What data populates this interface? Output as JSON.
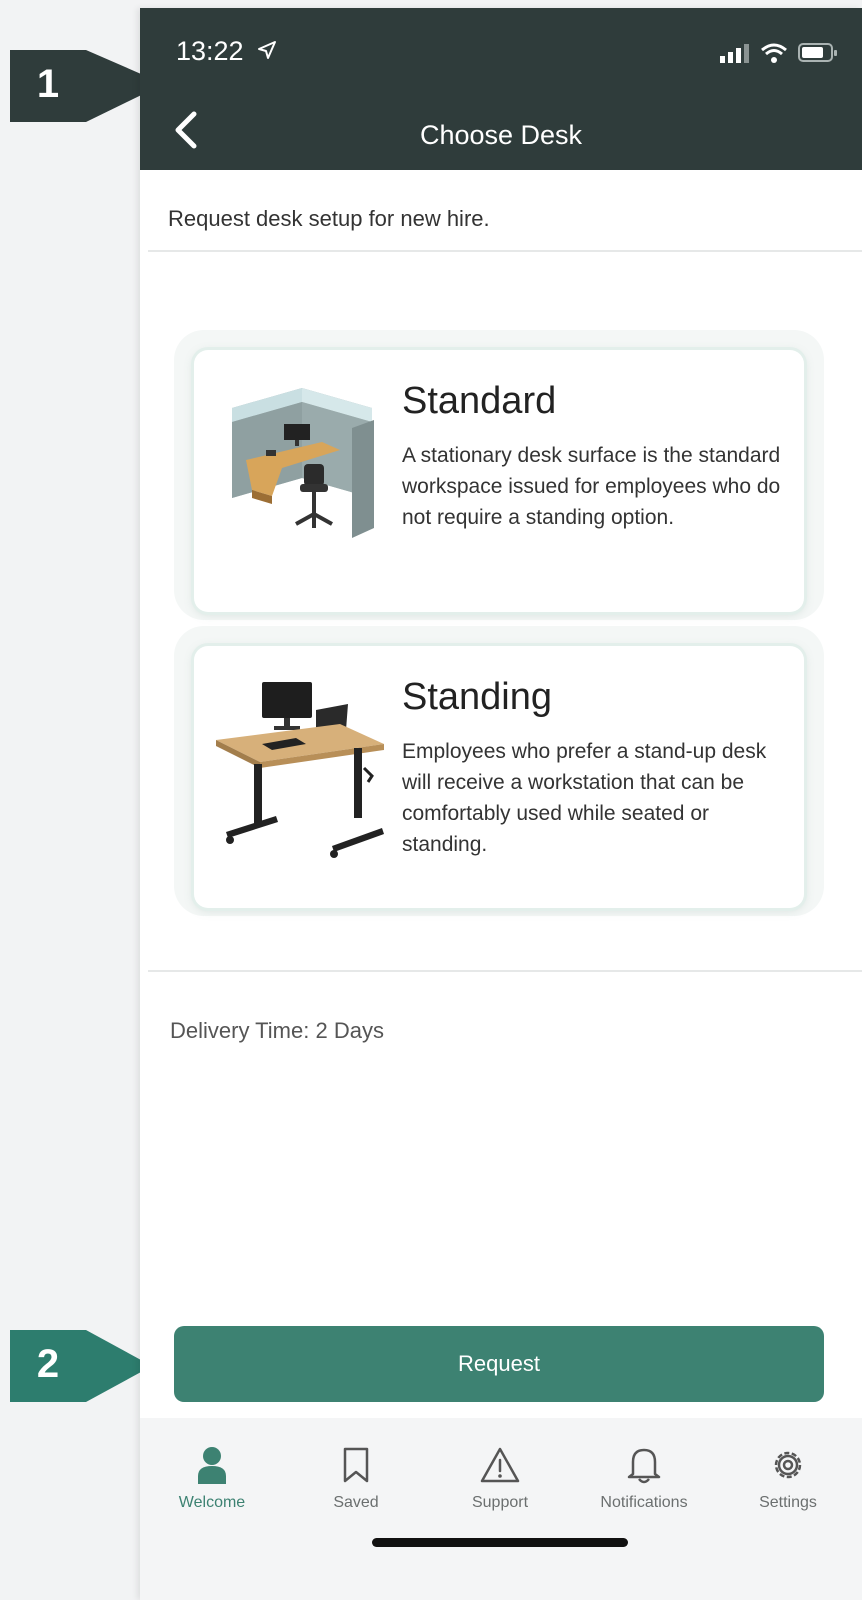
{
  "status_bar": {
    "time": "13:22"
  },
  "header": {
    "title": "Choose Desk"
  },
  "intro": "Request desk setup for new hire.",
  "desks": [
    {
      "title": "Standard",
      "description": "A stationary desk surface is the standard workspace issued for employees who do not require a standing option."
    },
    {
      "title": "Standing",
      "description": "Employees who prefer a stand-up desk will receive a workstation that can be comfortably used while seated or standing."
    }
  ],
  "delivery": "Delivery Time: 2 Days",
  "request_label": "Request",
  "tabs": [
    {
      "label": "Welcome",
      "icon": "person-icon"
    },
    {
      "label": "Saved",
      "icon": "bookmark-icon"
    },
    {
      "label": "Support",
      "icon": "warning-icon"
    },
    {
      "label": "Notifications",
      "icon": "bell-icon"
    },
    {
      "label": "Settings",
      "icon": "gear-icon"
    }
  ],
  "callouts": [
    "1",
    "2"
  ],
  "colors": {
    "header": "#2f3c3b",
    "accent": "#3d8272",
    "callout_2": "#2d7d6e"
  }
}
